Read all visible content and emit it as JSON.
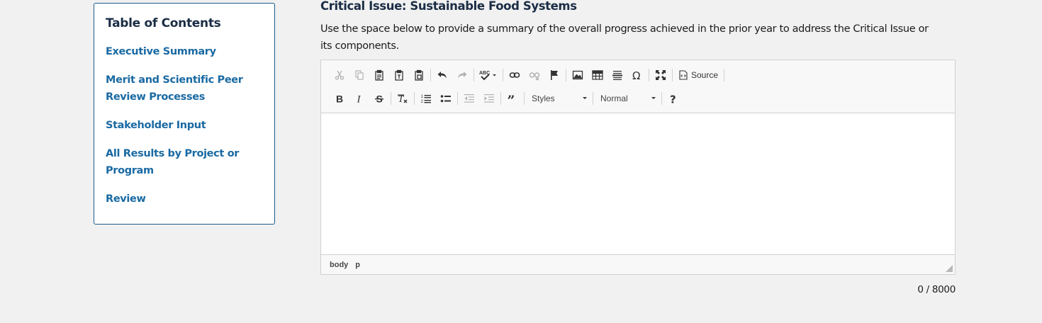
{
  "toc": {
    "title": "Table of Contents",
    "items": [
      {
        "label": "Executive Summary"
      },
      {
        "label": "Merit and Scientific Peer Review Processes"
      },
      {
        "label": "Stakeholder Input"
      },
      {
        "label": "All Results by Project or Program"
      },
      {
        "label": "Review"
      }
    ]
  },
  "main": {
    "title": "Critical Issue: Sustainable Food Systems",
    "description": "Use the space below to provide a summary of the overall progress achieved in the prior year to address the Critical Issue or its components."
  },
  "editor": {
    "toolbar": {
      "source_label": "Source",
      "styles_label": "Styles",
      "format_label": "Normal",
      "icons": [
        "cut-icon",
        "copy-icon",
        "paste-icon",
        "paste-text-icon",
        "paste-word-icon",
        "undo-icon",
        "redo-icon",
        "spellcheck-icon",
        "link-icon",
        "unlink-icon",
        "anchor-icon",
        "image-icon",
        "table-icon",
        "horizontal-rule-icon",
        "special-char-icon",
        "maximize-icon",
        "source-icon",
        "bold-icon",
        "italic-icon",
        "strike-icon",
        "remove-format-icon",
        "numbered-list-icon",
        "bulleted-list-icon",
        "outdent-icon",
        "indent-icon",
        "blockquote-icon",
        "help-icon"
      ]
    },
    "content": "",
    "path": {
      "body": "body",
      "p": "p"
    }
  },
  "char_count": "0 / 8000"
}
